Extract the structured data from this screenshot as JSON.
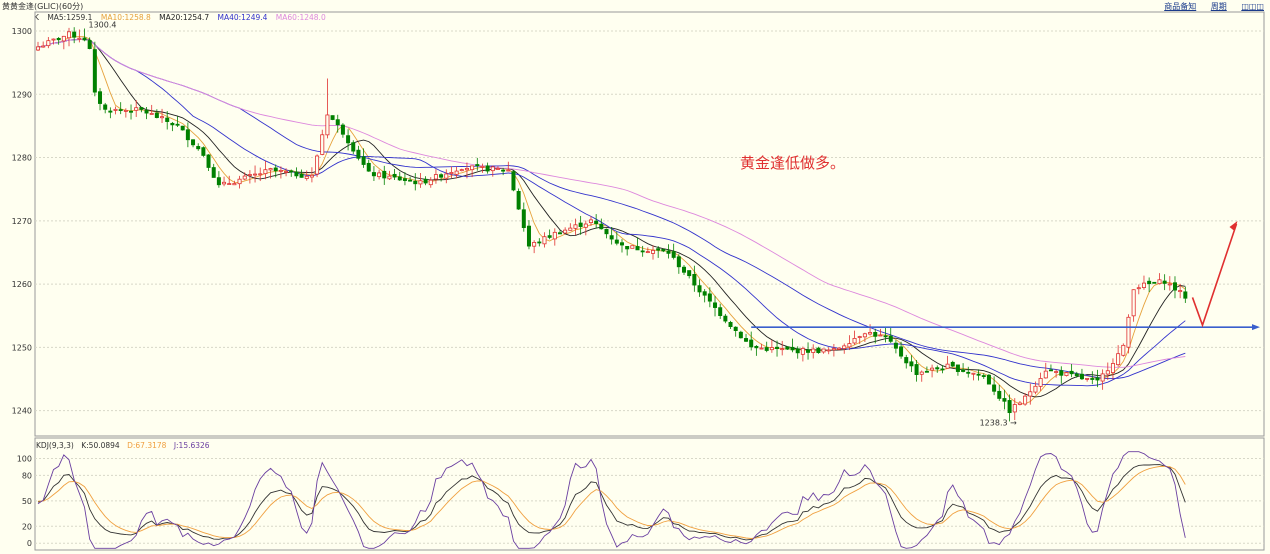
{
  "header": {
    "title": "黄黄金逢(GLIC)(60分)",
    "links": [
      "商品备知",
      "周期",
      "◫◫◫"
    ]
  },
  "main_legend": {
    "k_label": "K",
    "ma5": "MA5:1259.1",
    "ma10": "MA10:1258.8",
    "ma20": "MA20:1254.7",
    "ma40": "MA40:1249.4",
    "ma60": "MA60:1248.0"
  },
  "kdj_legend": {
    "name": "KDJ(9,3,3)",
    "k": "K:50.0894",
    "d": "D:67.3178",
    "j": "J:15.6326"
  },
  "annotation": "黄金逢低做多。",
  "colors": {
    "up": "#e03030",
    "down": "#008000",
    "ma5": "#e6a23c",
    "ma10": "#222222",
    "ma20": "#3333cc",
    "ma40": "#3333cc",
    "ma60": "#dd88dd",
    "blue_line": "#3a5fcd",
    "arrow": "#e03030",
    "kdj_k": "#333333",
    "kdj_d": "#f0a040",
    "kdj_j": "#6a3fa0"
  },
  "chart_data": [
    {
      "type": "candlestick",
      "yticks": [
        1300,
        1290,
        1280,
        1270,
        1260,
        1250,
        1240
      ],
      "ylim": [
        1236,
        1303
      ],
      "high_label": "1300.4",
      "low_label": "1238.3",
      "support_level": 1253.2,
      "close_path": [
        [
          0,
          1297.5
        ],
        [
          6,
          1299.5
        ],
        [
          9,
          1298.8
        ],
        [
          10,
          1297.0
        ],
        [
          11,
          1290.0
        ],
        [
          13,
          1287.5
        ],
        [
          20,
          1287.5
        ],
        [
          27,
          1285.0
        ],
        [
          32,
          1280.5
        ],
        [
          35,
          1275.5
        ],
        [
          45,
          1278.0
        ],
        [
          53,
          1277.0
        ],
        [
          56,
          1287.0
        ],
        [
          59,
          1284.0
        ],
        [
          64,
          1277.5
        ],
        [
          74,
          1276.0
        ],
        [
          82,
          1278.5
        ],
        [
          91,
          1278.0
        ],
        [
          95,
          1266.0
        ],
        [
          100,
          1268.0
        ],
        [
          107,
          1270.0
        ],
        [
          113,
          1266.0
        ],
        [
          122,
          1265.0
        ],
        [
          129,
          1258.0
        ],
        [
          138,
          1250.0
        ],
        [
          146,
          1249.5
        ],
        [
          154,
          1249.5
        ],
        [
          160,
          1252.5
        ],
        [
          164,
          1251.5
        ],
        [
          170,
          1246.0
        ],
        [
          176,
          1247.0
        ],
        [
          183,
          1245.5
        ],
        [
          188,
          1240.0
        ],
        [
          191,
          1242.0
        ],
        [
          195,
          1246.5
        ],
        [
          205,
          1244.5
        ],
        [
          210,
          1250.0
        ],
        [
          212,
          1259.5
        ],
        [
          218,
          1260.5
        ],
        [
          222,
          1258.0
        ]
      ],
      "ma_end_values": {
        "ma5": 1259.1,
        "ma10": 1258.8,
        "ma20": 1254.7,
        "ma40": 1249.4,
        "ma60": 1248.0
      }
    },
    {
      "type": "line",
      "title": "KDJ(9,3,3)",
      "yticks": [
        0,
        20,
        50,
        80,
        100
      ],
      "ylim": [
        -8,
        110
      ],
      "series": [
        {
          "name": "K",
          "last": 50.0894
        },
        {
          "name": "D",
          "last": 67.3178
        },
        {
          "name": "J",
          "last": 15.6326
        }
      ]
    }
  ]
}
